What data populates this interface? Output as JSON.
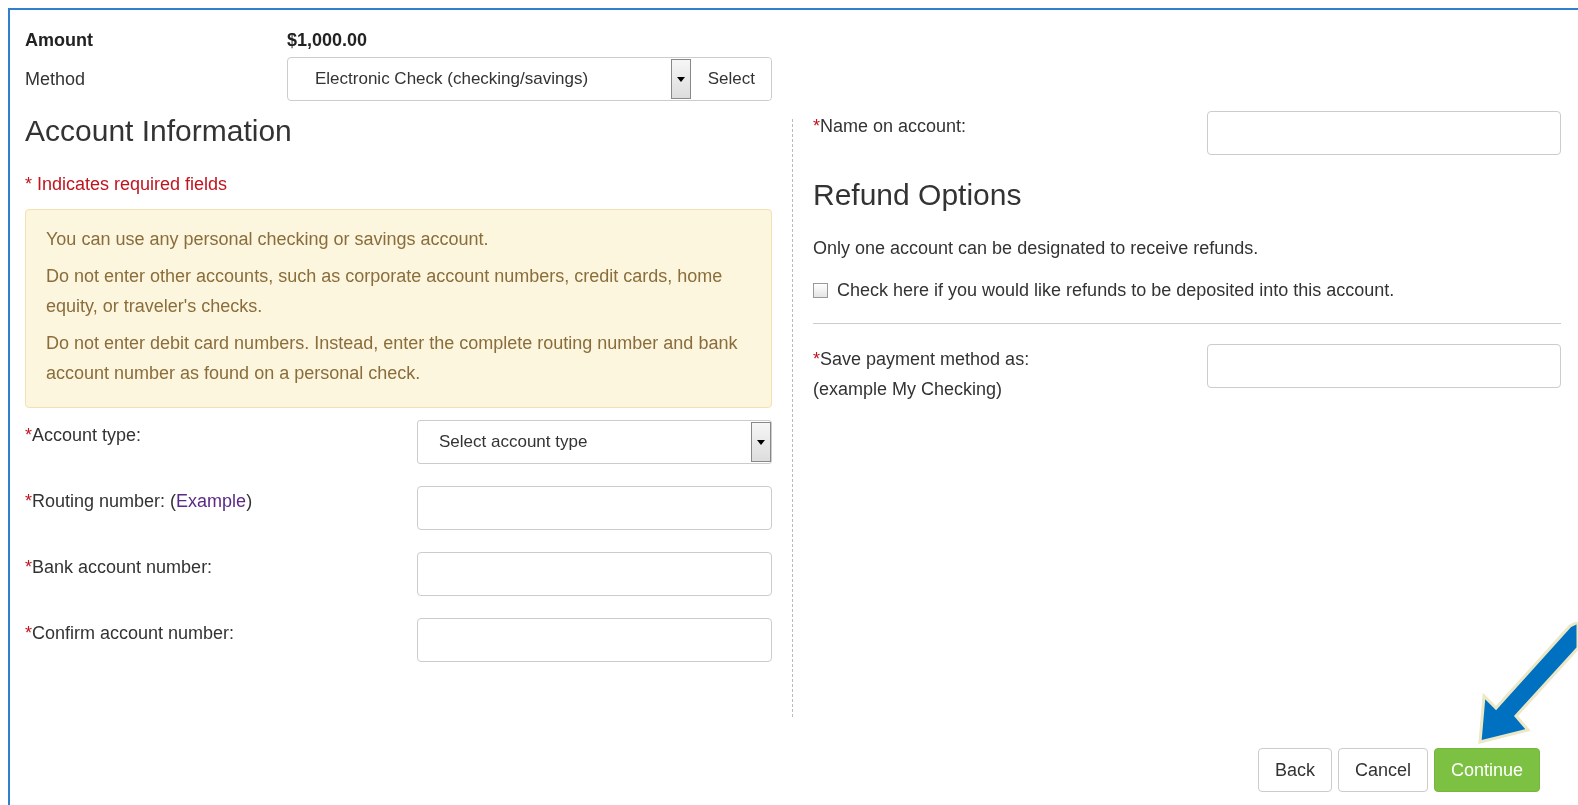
{
  "payment": {
    "amount_label": "Amount",
    "amount": "$1,000.00",
    "method_label": "Method",
    "method_value": "Electronic Check (checking/savings)",
    "select_button": "Select"
  },
  "account_info": {
    "title": "Account Information",
    "required_note": "* Indicates required fields",
    "notice": [
      "You can use any personal checking or savings account.",
      "Do not enter other accounts, such as corporate account numbers, credit cards, home equity, or traveler's checks.",
      "Do not enter debit card numbers. Instead, enter the complete routing number and bank account number as found on a personal check."
    ],
    "fields": [
      {
        "kind": "dropdown",
        "mark": "*",
        "label": "Account type:",
        "value": "Select account type"
      },
      {
        "kind": "text",
        "mark": "*",
        "label": "Routing number:",
        "link": {
          "open": "(",
          "text": "Example",
          "close": ")"
        }
      },
      {
        "kind": "text",
        "mark": "*",
        "label": "Bank account number:"
      },
      {
        "kind": "text",
        "mark": "*",
        "label": "Confirm account number:"
      }
    ]
  },
  "name_field": {
    "mark": "*",
    "label": "Name on account:"
  },
  "refund": {
    "title": "Refund Options",
    "note": "Only one account can be designated to receive refunds.",
    "checkbox": {
      "label": "Check here if you would like refunds to be deposited into this account.",
      "checked": false
    }
  },
  "save_field": {
    "mark": "*",
    "label": "Save payment method as:",
    "hint": "(example My Checking)"
  },
  "buttons": [
    {
      "label": "Back",
      "kind": "default"
    },
    {
      "label": "Cancel",
      "kind": "default"
    },
    {
      "label": "Continue",
      "kind": "primary"
    }
  ]
}
